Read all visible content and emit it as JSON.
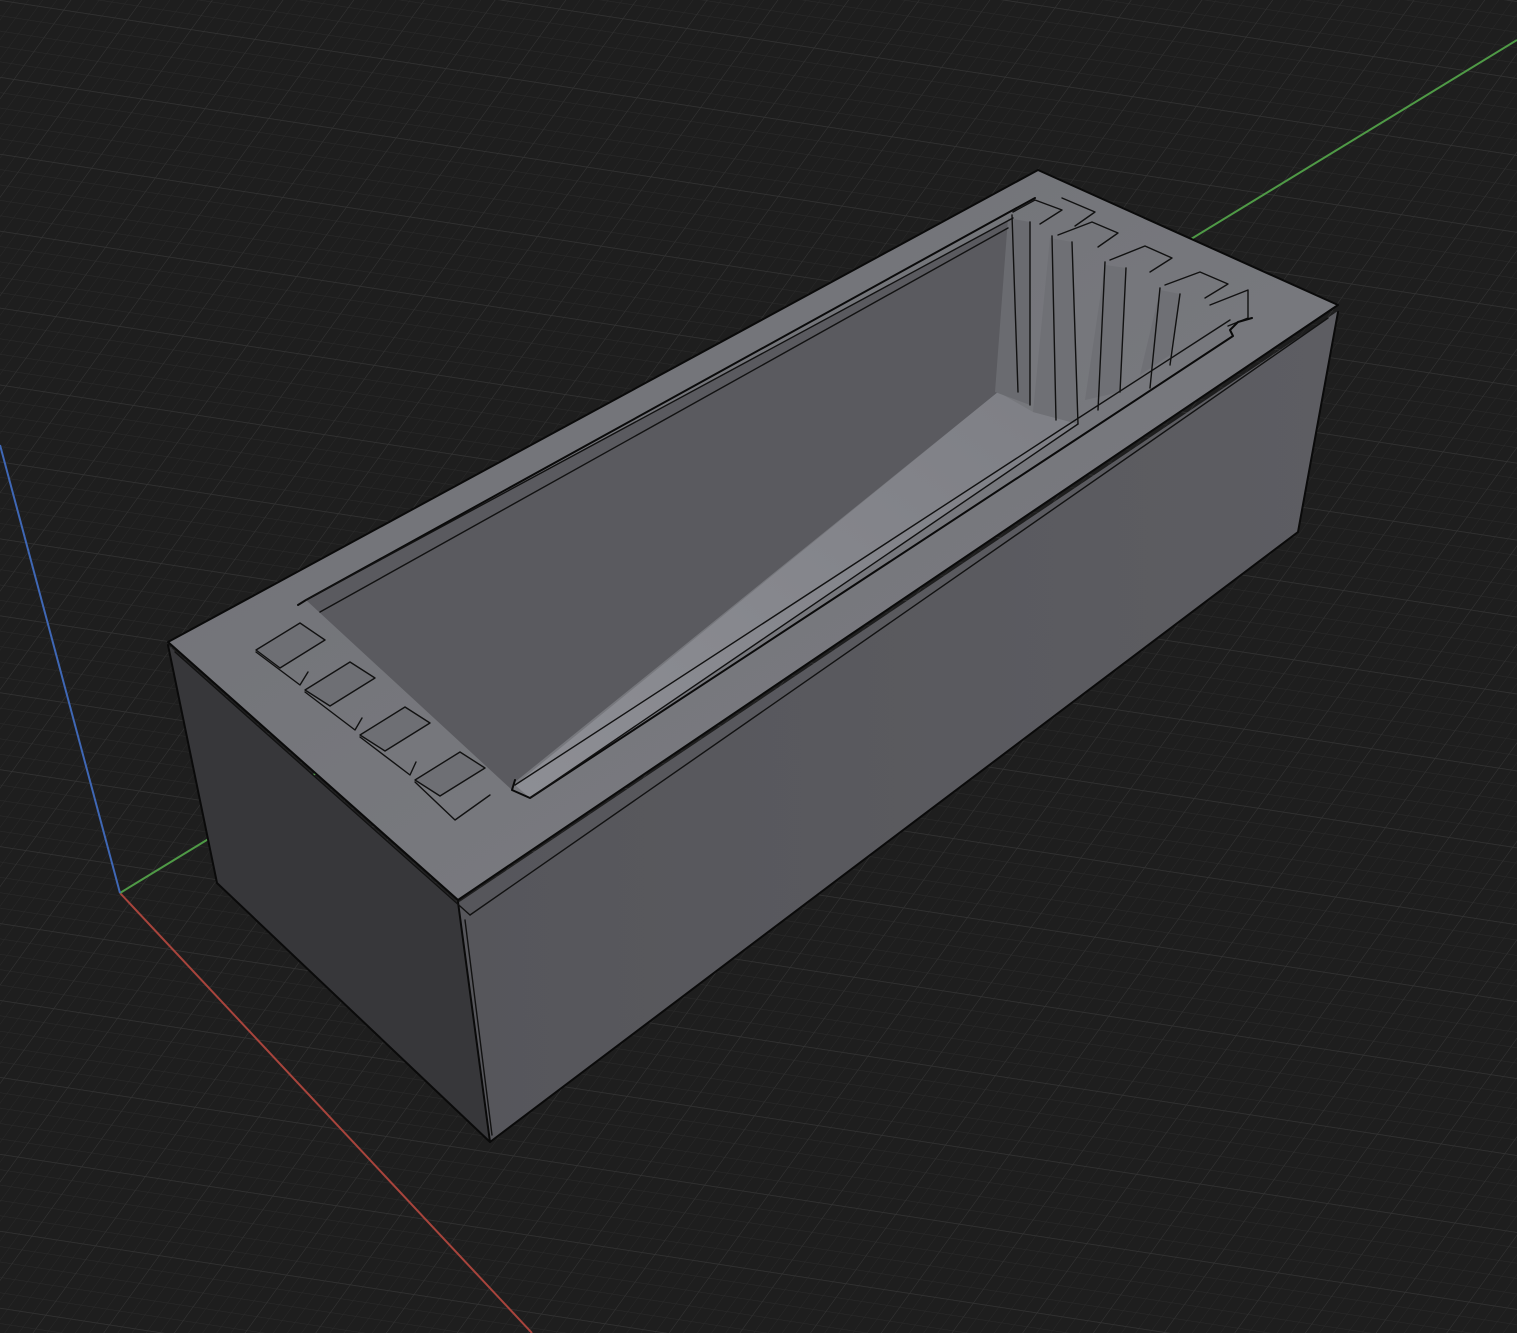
{
  "viewport": {
    "background": "#1e1e1e",
    "grid_minor_color": "#2a2a2a",
    "grid_major_color": "#333333"
  },
  "axes": {
    "x_color": "#b0473f",
    "y_color": "#4f9a46",
    "z_color": "#3f67b5"
  },
  "model": {
    "icon": "battery-holder-box",
    "top_color": "#7a7b80",
    "front_color": "#5c5c61",
    "side_color": "#38383b",
    "inner_color": "#626268",
    "floor_color": "#8a8b91",
    "slot_count_front": 4,
    "slot_count_back": 4
  }
}
